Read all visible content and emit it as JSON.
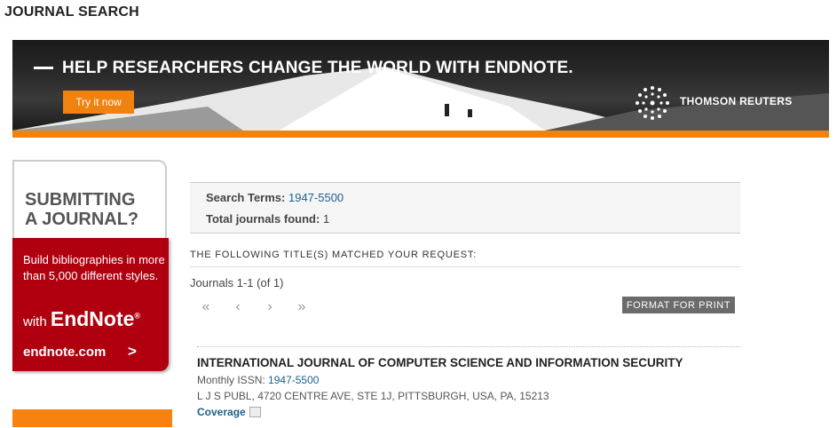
{
  "page": {
    "title": "JOURNAL SEARCH"
  },
  "banner": {
    "headline": "HELP RESEARCHERS CHANGE THE WORLD WITH ENDNOTE.",
    "cta": "Try it now",
    "brand": "THOMSON REUTERS"
  },
  "ad": {
    "heading_line1": "SUBMITTING",
    "heading_line2": "A JOURNAL?",
    "body": "Build bibliographies in more than 5,000 different styles.",
    "with": "with",
    "brand": "EndNote",
    "brand_mark": "®",
    "link": "endnote.com",
    "arrow": ">"
  },
  "search": {
    "terms_label": "Search Terms:",
    "terms_value": "1947-5500",
    "total_label": "Total journals found:",
    "total_value": "1"
  },
  "results": {
    "matched_heading": "THE FOLLOWING TITLE(S) MATCHED YOUR REQUEST:",
    "count": "Journals 1-1 (of 1)",
    "print_button": "FORMAT FOR PRINT",
    "pager": {
      "first": "«",
      "prev": "‹",
      "next": "›",
      "last": "»"
    },
    "items": [
      {
        "title": "INTERNATIONAL JOURNAL OF COMPUTER SCIENCE AND INFORMATION SECURITY",
        "issn_prefix": "Monthly ISSN:",
        "issn": "1947-5500",
        "publisher": "L J S PUBL, 4720 CENTRE AVE, STE 1J, PITTSBURGH, USA, PA, 15213",
        "coverage": "Coverage"
      }
    ]
  },
  "colors": {
    "accent_orange": "#f0820f",
    "ad_red": "#b0000f",
    "link_blue": "#1d6190"
  }
}
